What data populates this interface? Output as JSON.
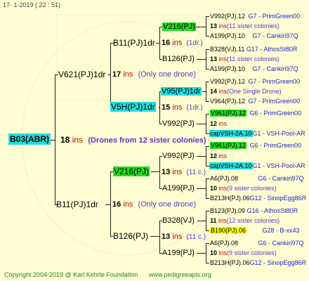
{
  "header": {
    "date": "17-   1-2019  ( 22 : 51)"
  },
  "footer": {
    "copyright": "Copyright 2004-2019 @ Karl Kehrle Foundation",
    "site": "www.pedigreeapis.org"
  },
  "colors": {
    "green": "#22dd22",
    "cyan": "#22dddd",
    "yellow": "#ffff00",
    "red": "#cc0000",
    "purple": "#6633cc",
    "blue": "#2222cc"
  },
  "root": {
    "id": "B03(ABR)",
    "num": "18",
    "ins": "ins",
    "note": "(Drones from 12 sister colonies)"
  },
  "gen1": {
    "top": {
      "id": "V621(PJ)1dr",
      "num": "17",
      "ins": "ins",
      "note": "(Only one drone)"
    },
    "bottom": {
      "id": "B11(PJ)1dr",
      "num": "16",
      "ins": "ins",
      "note": "(Only one drone)"
    }
  },
  "gen2": {
    "a": {
      "id": "B11(PJ)1dr",
      "num": "16",
      "ins": "ins",
      "note": "(1dr.)"
    },
    "b": {
      "id": "V5H(PJ)1dr",
      "num": "15",
      "ins": "ins",
      "note": "(1dr.)"
    },
    "c": {
      "id": "V216(PJ)",
      "num": "13",
      "ins": "ins",
      "note": "(11 c.)"
    },
    "d": {
      "id": "B126(PJ)",
      "num": "13",
      "ins": "ins",
      "note": "(11 c.)"
    }
  },
  "gen3": {
    "a": {
      "id": "V216(PJ)",
      "num": "16",
      "ins": "ins",
      "note": "(1dr.)"
    },
    "b": {
      "id": "B126(PJ)"
    },
    "c": {
      "id": "V95(PJ)1dr",
      "num": "14",
      "ins": "ins",
      "note": "(1dr.)"
    },
    "d": {
      "id": "V992(PJ)"
    },
    "e": {
      "id": "V992(PJ)"
    },
    "f": {
      "id": "A199(PJ)",
      "num": "10",
      "ins": "ins",
      "note": "(9 c.)"
    },
    "g": {
      "id": "B328(VJ)",
      "num": "11",
      "ins": "ins",
      "note": "(12 c.)"
    },
    "h": {
      "id": "A199(PJ)"
    }
  },
  "gen4": [
    {
      "id": "V992(PJ).12",
      "info": "G7 - PrimGreen00"
    },
    {
      "num": "13",
      "ins": "ins",
      "note": "(11 sister colonies)"
    },
    {
      "id": "A199(PJ).10",
      "info": "G7 - Cankiri97Q"
    },
    {
      "id": "B328(VJ).11",
      "info": "G17 - AthosSt80R"
    },
    {
      "num": "13",
      "ins": "ins",
      "note": "(11 sister colonies)"
    },
    {
      "id": "A199(PJ).10",
      "info": "G7 - Cankiri97Q"
    },
    {
      "id": "V992(PJ).12",
      "info": "G7 - PrimGreen00"
    },
    {
      "num": "14",
      "ins": "ins",
      "note": "(One Single Drone)"
    },
    {
      "id": "V964(PJ).12",
      "info": "G7 - PrimGreen00"
    },
    {
      "id": "V961(PJ).12",
      "info": "G6 - PrimGreen00"
    },
    {
      "num": "12",
      "ins": "ins",
      "note": ""
    },
    {
      "id": "capVSH-2A.10",
      "info": "G1 - VSH-Pool-AR"
    },
    {
      "id": "V961(PJ).12",
      "info": "G6 - PrimGreen00"
    },
    {
      "num": "12",
      "ins": "ins",
      "note": ""
    },
    {
      "id": "capVSH-2A.10",
      "info": "G1 - VSH-Pool-AR"
    },
    {
      "id": "A6(PJ).08",
      "info": "G6 - Cankiri97Q"
    },
    {
      "num": "10",
      "ins": "ins",
      "note": "(9 sister colonies)"
    },
    {
      "id": "B213H(PJ).06",
      "info": "G12 - SinopEgg86R"
    },
    {
      "id": "B123(PJ).09",
      "info": "G16 - AthosSt80R"
    },
    {
      "num": "11",
      "ins": "ins",
      "note": "(12 sister colonies)"
    },
    {
      "id": "B190(PJ).06",
      "info": "G28 - B-xx43"
    },
    {
      "id": "A6(PJ).08",
      "info": "G6 - Cankiri97Q"
    },
    {
      "num": "10",
      "ins": "ins",
      "note": "(9 sister colonies)"
    },
    {
      "id": "B213H(PJ).06",
      "info": "G12 - SinopEgg86R"
    }
  ]
}
